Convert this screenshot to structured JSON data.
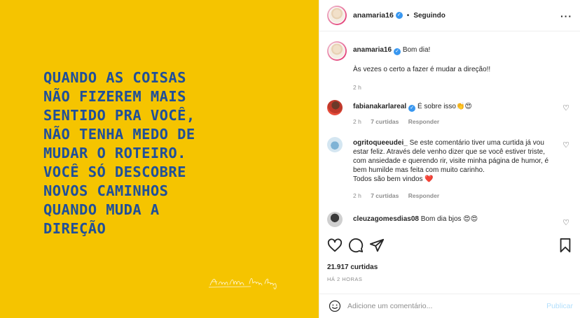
{
  "post": {
    "quote_lines": [
      "QUANDO AS COISAS",
      "NÃO FIZEREM MAIS",
      "SENTIDO PRA VOCÊ,",
      "NÃO TENHA MEDO DE",
      "MUDAR O ROTEIRO.",
      "VOCÊ SÓ DESCOBRE",
      "NOVOS CAMINHOS",
      "QUANDO MUDA A",
      "DIREÇÃO"
    ],
    "signature": "Ana Maria Braga",
    "background_color": "#f5c400",
    "text_color": "#1f4f9a"
  },
  "header": {
    "username": "anamaria16",
    "separator": "•",
    "follow_status": "Seguindo",
    "more_icon": "more-options-icon"
  },
  "caption": {
    "username": "anamaria16",
    "text_line1": "Bom dia!",
    "text_line2": "Às vezes o certo a fazer é mudar a direção!!",
    "time": "2 h"
  },
  "comments": [
    {
      "username": "fabianakarlareal",
      "text": "É sobre isso👏😍",
      "time": "2 h",
      "likes": "7 curtidas",
      "reply": "Responder"
    },
    {
      "username": "ogritoqueeudei_",
      "text": "Se este comentário tiver uma curtida já vou estar feliz. Através dele venho dizer que se você estiver triste, com ansiedade e querendo rir, visite minha página de humor, é bem humilde mas feita com muito carinho.",
      "text_line2": "Todos são bem vindos ❤️",
      "time": "2 h",
      "likes": "7 curtidas",
      "reply": "Responder"
    },
    {
      "username": "cleuzagomesdias08",
      "text": "Bom dia bjos 😍😍"
    }
  ],
  "actions": {
    "like_icon": "heart-icon",
    "comment_icon": "comment-icon",
    "share_icon": "share-icon",
    "save_icon": "bookmark-icon"
  },
  "likes": "21.917 curtidas",
  "timestamp": "HÁ 2 HORAS",
  "add_comment": {
    "placeholder": "Adicione um comentário...",
    "publish_label": "Publicar"
  },
  "colors": {
    "accent_blue": "#3897f0",
    "muted": "#8e8e8e",
    "publish_disabled": "#b2dffc"
  }
}
